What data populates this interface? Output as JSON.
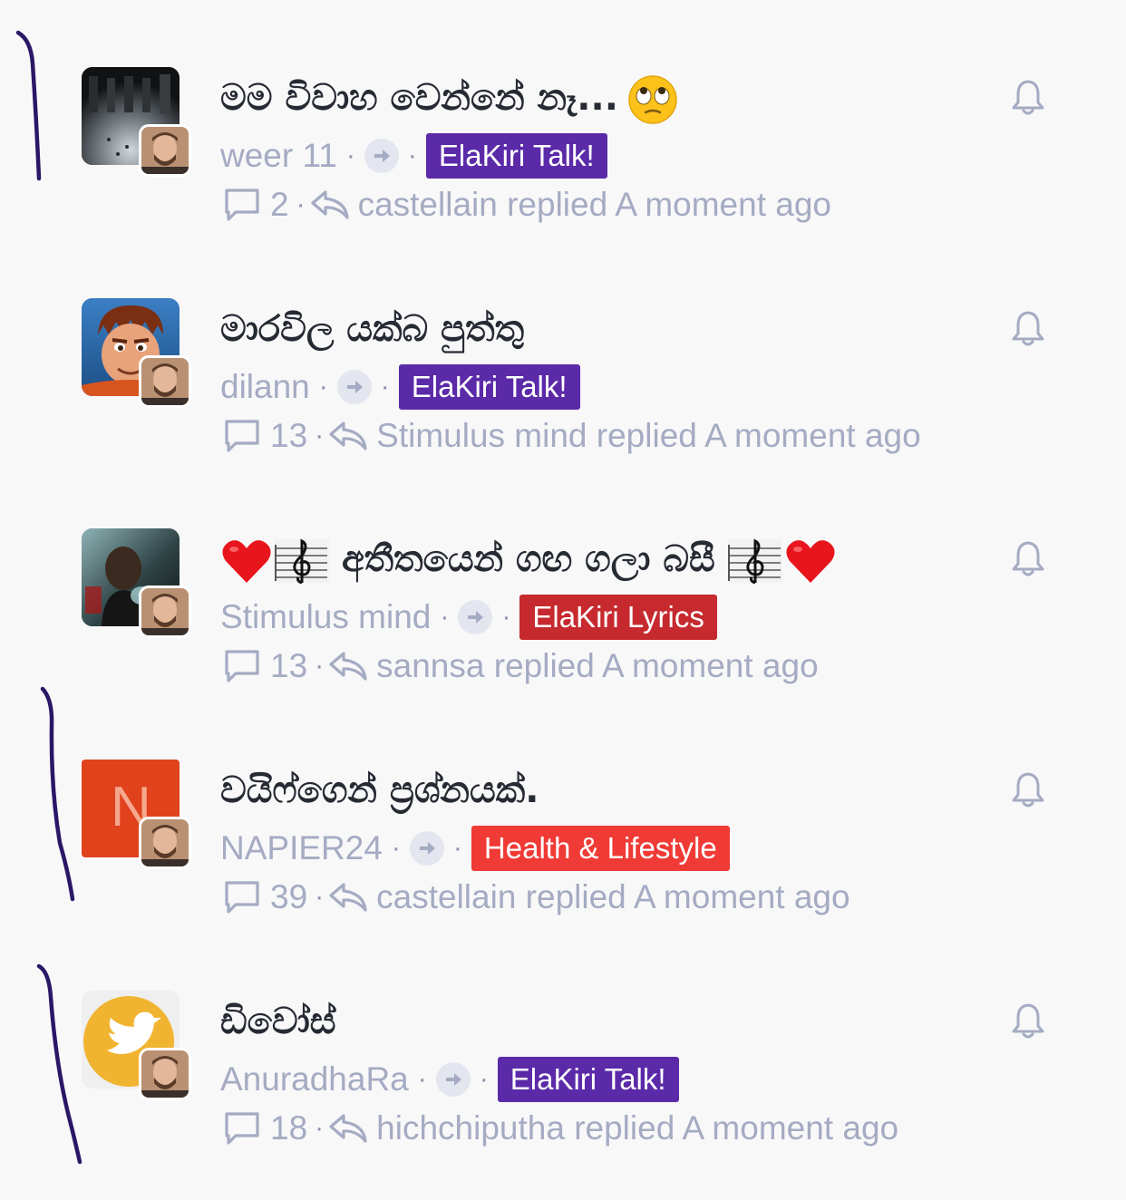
{
  "colors": {
    "background": "#f8f8f9",
    "title": "#262a33",
    "muted": "#a4abc2",
    "ink": "#2a1766"
  },
  "topics": [
    {
      "title": "මම විවාහ වෙන්නේ නෑ...",
      "title_emoji": "face-with-rolling-eyes",
      "author": "weer 11",
      "category": "ElaKiri Talk!",
      "category_color": "#5b2aa8",
      "replies": "2",
      "last_reply": "castellain replied A moment ago",
      "thumbnail": "dark-scene-image"
    },
    {
      "title": "මාරවිල යක්බ පුත්තු",
      "author": "dilann",
      "category": "ElaKiri Talk!",
      "category_color": "#5b2aa8",
      "replies": "13",
      "last_reply": "Stimulus mind replied A moment ago",
      "thumbnail": "cartoon-character-image"
    },
    {
      "title": "අතීතයෙන් ගඟ ගලා බසී",
      "title_emoji": "heart-and-treble-clef",
      "author": "Stimulus mind",
      "category": "ElaKiri Lyrics",
      "category_color": "#c62a2f",
      "replies": "13",
      "last_reply": "sannsa replied A moment ago",
      "thumbnail": "movie-scene-image"
    },
    {
      "title": "වයිෆ්ගෙන් ප්‍රශ්නයක්.",
      "author": "NAPIER24",
      "category": "Health & Lifestyle",
      "category_color": "#f03a35",
      "replies": "39",
      "last_reply": "castellain replied A moment ago",
      "thumbnail": "letter-avatar",
      "thumbnail_letter": "N",
      "thumbnail_color": "#e0421b"
    },
    {
      "title": "ඩිවෝස්",
      "author": "AnuradhaRa",
      "category": "ElaKiri Talk!",
      "category_color": "#5b2aa8",
      "replies": "18",
      "last_reply": "hichchiputha replied A moment ago",
      "thumbnail": "twitter-bird-icon"
    }
  ]
}
